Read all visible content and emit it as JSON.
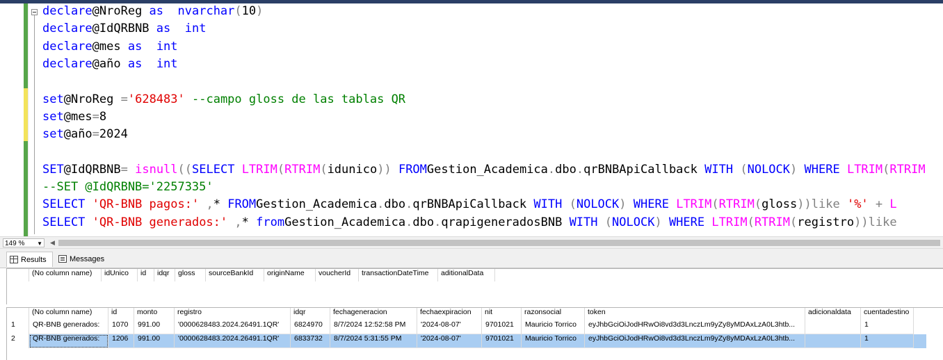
{
  "editor": {
    "lines": [
      [
        [
          "kw",
          "declare"
        ],
        [
          "",
          "@NroReg "
        ],
        [
          "kw",
          "as"
        ],
        [
          "",
          "  "
        ],
        [
          "kw",
          "nvarchar"
        ],
        [
          "gr",
          "("
        ],
        [
          "",
          "10"
        ],
        [
          "gr",
          ")"
        ]
      ],
      [
        [
          "kw",
          "declare"
        ],
        [
          "",
          "@IdQRBNB "
        ],
        [
          "kw",
          "as"
        ],
        [
          "",
          "  "
        ],
        [
          "kw",
          "int"
        ]
      ],
      [
        [
          "kw",
          "declare"
        ],
        [
          "",
          "@mes "
        ],
        [
          "kw",
          "as"
        ],
        [
          "",
          "  "
        ],
        [
          "kw",
          "int"
        ]
      ],
      [
        [
          "kw",
          "declare"
        ],
        [
          "",
          "@año "
        ],
        [
          "kw",
          "as"
        ],
        [
          "",
          "  "
        ],
        [
          "kw",
          "int"
        ]
      ],
      [],
      [
        [
          "kw",
          "set"
        ],
        [
          "",
          "@NroReg "
        ],
        [
          "gr",
          "="
        ],
        [
          "str",
          "'628483'"
        ],
        [
          "",
          ""
        ],
        [
          "com",
          "--campo gloss de las tablas QR"
        ]
      ],
      [
        [
          "kw",
          "set"
        ],
        [
          "",
          "@mes"
        ],
        [
          "gr",
          "="
        ],
        [
          "",
          "8"
        ]
      ],
      [
        [
          "kw",
          "set"
        ],
        [
          "",
          "@año"
        ],
        [
          "gr",
          "="
        ],
        [
          "",
          "2024"
        ]
      ],
      [],
      [
        [
          "kw",
          "SET"
        ],
        [
          "",
          "@IdQRBNB"
        ],
        [
          "gr",
          "="
        ],
        [
          "",
          ""
        ],
        [
          "fn",
          "isnull"
        ],
        [
          "gr",
          "(("
        ],
        [
          "kw",
          "SELECT"
        ],
        [
          "",
          ""
        ],
        [
          "fn",
          "LTRIM"
        ],
        [
          "gr",
          "("
        ],
        [
          "fn",
          "RTRIM"
        ],
        [
          "gr",
          "("
        ],
        [
          "",
          "idunico"
        ],
        [
          "gr",
          "))"
        ],
        [
          "",
          ""
        ],
        [
          "kw",
          "FROM"
        ],
        [
          "",
          "Gestion_Academica"
        ],
        [
          "gr",
          "."
        ],
        [
          "",
          "dbo"
        ],
        [
          "gr",
          "."
        ],
        [
          "",
          "qrBNBApiCallback"
        ],
        [
          "",
          ""
        ],
        [
          "kw",
          "WITH"
        ],
        [
          "",
          ""
        ],
        [
          "gr",
          "("
        ],
        [
          "kw",
          "NOLOCK"
        ],
        [
          "gr",
          ")"
        ],
        [
          "",
          ""
        ],
        [
          "kw",
          "WHERE"
        ],
        [
          "",
          ""
        ],
        [
          "fn",
          "LTRIM"
        ],
        [
          "gr",
          "("
        ],
        [
          "fn",
          "RTRIM"
        ]
      ],
      [
        [
          "com",
          "--SET @IdQRBNB='2257335'"
        ]
      ],
      [
        [
          "kw",
          "SELECT"
        ],
        [
          "",
          ""
        ],
        [
          "str",
          "'QR-BNB pagos:'"
        ],
        [
          "",
          ""
        ],
        [
          "gr",
          ","
        ],
        [
          "",
          "*"
        ],
        [
          "",
          ""
        ],
        [
          "kw",
          "FROM"
        ],
        [
          "",
          "Gestion_Academica"
        ],
        [
          "gr",
          "."
        ],
        [
          "",
          "dbo"
        ],
        [
          "gr",
          "."
        ],
        [
          "",
          "qrBNBApiCallback"
        ],
        [
          "",
          ""
        ],
        [
          "kw",
          "WITH"
        ],
        [
          "",
          ""
        ],
        [
          "gr",
          "("
        ],
        [
          "kw",
          "NOLOCK"
        ],
        [
          "gr",
          ")"
        ],
        [
          "",
          ""
        ],
        [
          "kw",
          "WHERE"
        ],
        [
          "",
          ""
        ],
        [
          "fn",
          "LTRIM"
        ],
        [
          "gr",
          "("
        ],
        [
          "fn",
          "RTRIM"
        ],
        [
          "gr",
          "("
        ],
        [
          "",
          "gloss"
        ],
        [
          "gr",
          "))"
        ],
        [
          "gr",
          "like"
        ],
        [
          "",
          ""
        ],
        [
          "str",
          "'%'"
        ],
        [
          "",
          ""
        ],
        [
          "gr",
          "+"
        ],
        [
          "",
          ""
        ],
        [
          "fn",
          "L"
        ]
      ],
      [
        [
          "kw",
          "SELECT"
        ],
        [
          "",
          ""
        ],
        [
          "str",
          "'QR-BNB generados:'"
        ],
        [
          "",
          ""
        ],
        [
          "gr",
          ","
        ],
        [
          "",
          "*"
        ],
        [
          "",
          ""
        ],
        [
          "kw",
          "from"
        ],
        [
          "",
          "Gestion_Academica"
        ],
        [
          "gr",
          "."
        ],
        [
          "",
          "dbo"
        ],
        [
          "gr",
          "."
        ],
        [
          "",
          "qrapigeneradosBNB"
        ],
        [
          "",
          ""
        ],
        [
          "kw",
          "WITH"
        ],
        [
          "",
          ""
        ],
        [
          "gr",
          "("
        ],
        [
          "kw",
          "NOLOCK"
        ],
        [
          "gr",
          ")"
        ],
        [
          "",
          ""
        ],
        [
          "kw",
          "WHERE"
        ],
        [
          "",
          ""
        ],
        [
          "fn",
          "LTRIM"
        ],
        [
          "gr",
          "("
        ],
        [
          "fn",
          "RTRIM"
        ],
        [
          "gr",
          "("
        ],
        [
          "",
          "registro"
        ],
        [
          "gr",
          "))"
        ],
        [
          "gr",
          "like"
        ]
      ]
    ]
  },
  "zoom": {
    "value": "149 %"
  },
  "tabs": {
    "results": "Results",
    "messages": "Messages"
  },
  "grid1": {
    "columns": [
      "(No column name)",
      "idUnico",
      "id",
      "idqr",
      "gloss",
      "sourceBankId",
      "originName",
      "voucherId",
      "transactionDateTime",
      "aditionalData"
    ]
  },
  "grid2": {
    "columns": [
      "(No column name)",
      "id",
      "monto",
      "registro",
      "idqr",
      "fechageneracion",
      "fechaexpiracion",
      "nit",
      "razonsocial",
      "token",
      "adicionaldata",
      "cuentadestino"
    ],
    "rows": [
      {
        "n": "1",
        "cells": [
          "QR-BNB generados:",
          "1070",
          "991.00",
          "'0000628483.2024.26491.1QR'",
          "6824970",
          "8/7/2024 12:52:58 PM",
          "'2024-08-07'",
          "9701021",
          "Mauricio Torrico",
          "eyJhbGciOiJodHRwOi8vd3d3LnczLm9yZy8yMDAxLzA0L3htb...",
          "",
          "1"
        ]
      },
      {
        "n": "2",
        "cells": [
          "QR-BNB generados:",
          "1206",
          "991.00",
          "'0000628483.2024.26491.1QR'",
          "6833732",
          "8/7/2024 5:31:55 PM",
          "'2024-08-07'",
          "9701021",
          "Mauricio Torrico",
          "eyJhbGciOiJodHRwOi8vd3d3LnczLm9yZy8yMDAxLzA0L3htb...",
          "",
          "1"
        ]
      }
    ]
  }
}
